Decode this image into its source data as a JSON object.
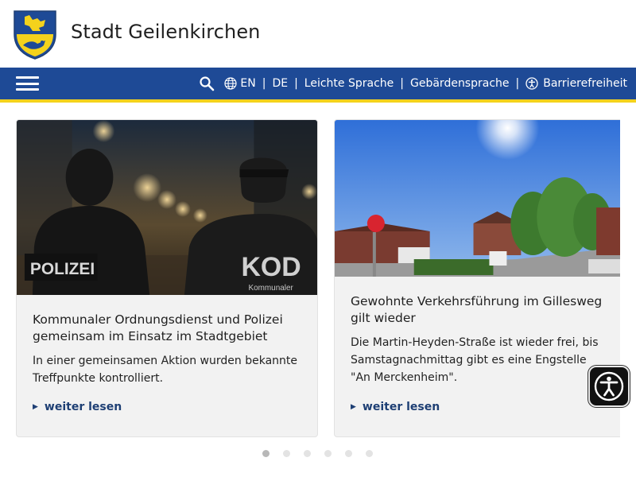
{
  "header": {
    "site_title": "Stadt Geilenkirchen",
    "crest_icon": "city-crest-icon"
  },
  "nav": {
    "menu_icon": "hamburger-menu-icon",
    "search_icon": "search-icon",
    "globe_icon": "globe-icon",
    "links": {
      "en": "EN",
      "de": "DE",
      "easy_language": "Leichte Sprache",
      "sign_language": "Gebärdensprache",
      "accessibility": "Barrierefreiheit"
    },
    "separator": "|",
    "colors": {
      "bar": "#1e4a96",
      "stripe": "#f4d21c"
    }
  },
  "carousel": {
    "cards": [
      {
        "image_text_left": "POLIZEI",
        "image_text_right": "KOD",
        "image_subtext_right": "Kommunaler",
        "title": "Kommunaler Ordnungsdienst und Polizei gemeinsam im Einsatz im Stadtgebiet",
        "text": "In einer gemeinsamen Aktion wurden bekannte Treffpunkte kontrolliert.",
        "link": "weiter lesen"
      },
      {
        "title": "Gewohnte Verkehrsführung im Gillesweg gilt wieder",
        "text": "Die Martin-Heyden-Straße ist wieder frei, bis Samstagnachmittag gibt es eine Engstelle \"An Merckenheim\".",
        "link": "weiter lesen"
      }
    ],
    "dots": 6,
    "active_dot": 1,
    "link_color": "#1e3f74"
  },
  "accessibility_widget": {
    "icon": "accessibility-person-icon"
  }
}
